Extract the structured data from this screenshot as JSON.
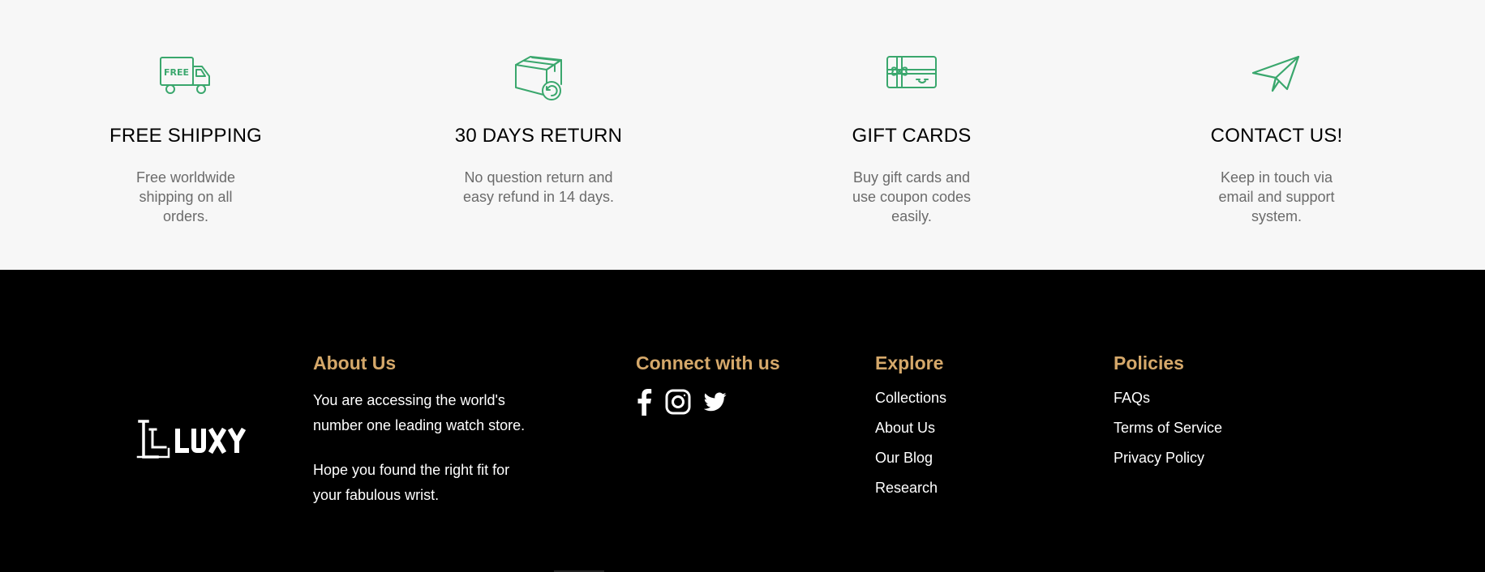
{
  "features": [
    {
      "icon": "free-shipping-truck-icon",
      "icon_text": "FREE",
      "title": "FREE SHIPPING",
      "desc": "Free worldwide shipping on all orders."
    },
    {
      "icon": "return-box-icon",
      "title": "30 DAYS RETURN",
      "desc": "No question return and easy refund in 14 days."
    },
    {
      "icon": "gift-card-icon",
      "title": "GIFT CARDS",
      "desc": "Buy gift cards and use coupon codes easily."
    },
    {
      "icon": "paper-plane-icon",
      "title": "CONTACT US!",
      "desc": "Keep in touch via email and support system."
    }
  ],
  "colors": {
    "icon_green": "#3aa76d",
    "heading_gold": "#d5a86a",
    "feature_bg": "#f7f7f7",
    "footer_bg": "#000000"
  },
  "footer": {
    "logo_text": "LLUXY",
    "about": {
      "heading": "About Us",
      "text1": "You are accessing the world's number one leading watch store.",
      "text2": "Hope you found the right fit for your fabulous wrist."
    },
    "connect": {
      "heading": "Connect with us",
      "icons": [
        "facebook-icon",
        "instagram-icon",
        "twitter-icon"
      ]
    },
    "explore": {
      "heading": "Explore",
      "links": [
        "Collections",
        "About Us",
        "Our Blog",
        "Research"
      ]
    },
    "policies": {
      "heading": "Policies",
      "links": [
        "FAQs",
        "Terms of Service",
        "Privacy Policy"
      ]
    }
  }
}
